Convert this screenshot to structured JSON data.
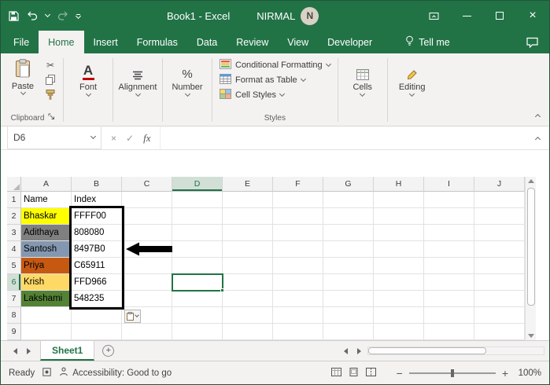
{
  "titlebar": {
    "title": "Book1 - Excel",
    "user_name": "NIRMAL",
    "avatar_initial": "N"
  },
  "tabs": {
    "file": "File",
    "home": "Home",
    "insert": "Insert",
    "formulas": "Formulas",
    "data": "Data",
    "review": "Review",
    "view": "View",
    "developer": "Developer",
    "tell_me": "Tell me"
  },
  "ribbon": {
    "paste_label": "Paste",
    "clipboard_group": "Clipboard",
    "font_label": "Font",
    "alignment_label": "Alignment",
    "number_label": "Number",
    "conditional_formatting": "Conditional Formatting",
    "format_as_table": "Format as Table",
    "cell_styles": "Cell Styles",
    "styles_group": "Styles",
    "cells_label": "Cells",
    "editing_label": "Editing"
  },
  "formula_bar": {
    "name_box": "D6",
    "fx_label": "fx",
    "formula_value": ""
  },
  "grid": {
    "columns": [
      "A",
      "B",
      "C",
      "D",
      "E",
      "F",
      "G",
      "H",
      "I",
      "J"
    ],
    "rows": [
      "1",
      "2",
      "3",
      "4",
      "5",
      "6",
      "7",
      "8",
      "9"
    ],
    "selected_cell": "D6",
    "cells": {
      "a1": "Name",
      "b1": "Index",
      "a2": "Bhaskar",
      "b2": "FFFF00",
      "a3": "Adithaya",
      "b3": "808080",
      "a4": "Santosh",
      "b4": "8497B0",
      "a5": "Priya",
      "b5": "C65911",
      "a6": "Krish",
      "b6": "FFD966",
      "a7": "Lakshami",
      "b7": "548235"
    },
    "fills": {
      "a2": "#FFFF00",
      "a3": "#808080",
      "a4": "#8497B0",
      "a5": "#C65911",
      "a6": "#FFD966",
      "a7": "#548235"
    }
  },
  "sheet_bar": {
    "sheet_name": "Sheet1"
  },
  "status_bar": {
    "mode": "Ready",
    "accessibility": "Accessibility: Good to go",
    "zoom_level": "100%"
  },
  "colors": {
    "excel_green": "#217346",
    "range_highlight_border": "#000000"
  }
}
